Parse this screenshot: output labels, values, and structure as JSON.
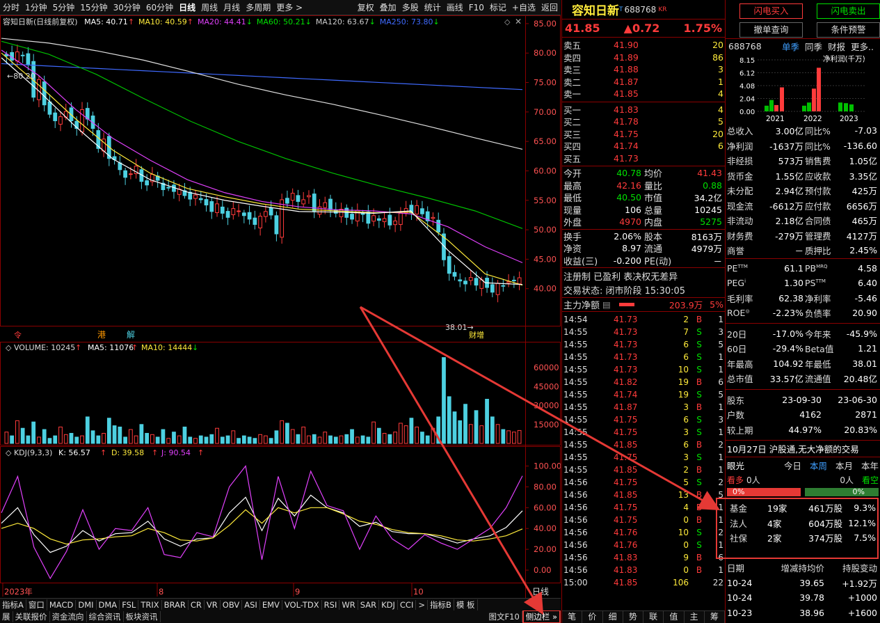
{
  "toolbar": {
    "left": [
      "分时",
      "1分钟",
      "5分钟",
      "15分钟",
      "30分钟",
      "60分钟",
      "日线",
      "周线",
      "月线",
      "多周期",
      "更多 >"
    ],
    "right": [
      "复权",
      "叠加",
      "多股",
      "统计",
      "画线",
      "F10",
      "标记",
      "+自选",
      "返回"
    ]
  },
  "chart": {
    "stock_title": "容知日新(日线前复权)",
    "ma": [
      {
        "label": "MA5: 40.71",
        "arrow": "↑",
        "color": "#ffffff"
      },
      {
        "label": "MA10: 40.59",
        "arrow": "↑",
        "color": "#ffeb3b"
      },
      {
        "label": "MA20: 44.41",
        "arrow": "↓",
        "color": "#e040fb"
      },
      {
        "label": "MA60: 50.21",
        "arrow": "↓",
        "color": "#00e000"
      },
      {
        "label": "MA120: 63.67",
        "arrow": "↓",
        "color": "#cccccc"
      },
      {
        "label": "MA250: 73.80",
        "arrow": "↓",
        "color": "#3f6aff"
      }
    ],
    "high_label": "80.20",
    "low_label": "38.01",
    "event_labels": [
      "港",
      "解",
      "财增"
    ],
    "volume_title": "VOLUME: 10245",
    "volume_ma5": "MA5: 11076",
    "volume_ma10": "MA10: 14444",
    "kdj_title": "KDJ(9,3,3)",
    "kdj_k": "K: 56.57",
    "kdj_d": "D: 39.58",
    "kdj_j": "J: 90.54",
    "x_labels": [
      "2023年",
      "8",
      "9",
      "10"
    ],
    "cycle_label": "日线"
  },
  "chart_data": [
    {
      "type": "candlestick",
      "title": "容知日新(日线前复权)",
      "ylim": [
        35,
        87
      ],
      "yticks": [
        40,
        45,
        50,
        55,
        60,
        65,
        70,
        75,
        80,
        85
      ],
      "close": [
        79.5,
        78.8,
        80.2,
        79.6,
        78.1,
        72.5,
        75.5,
        71.2,
        69.6,
        68.5,
        69.2,
        70.1,
        68.5,
        67.2,
        70.4,
        68.8,
        67.2,
        63.8,
        65.4,
        62.1,
        61.9,
        60.2,
        58.9,
        59.5,
        60.8,
        58.2,
        57.6,
        59.4,
        58.4,
        56.8,
        57.2,
        56.5,
        56.9,
        55.8,
        55.2,
        55.9,
        55.1,
        54.2,
        53.1,
        54.4,
        52.8,
        52.1,
        53.6,
        53.2,
        52.4,
        51.8,
        50.9,
        52.3,
        53.1,
        52.5,
        49.3,
        55.1,
        54.5,
        56.2,
        54.8,
        55.1,
        55.8,
        53.2,
        53.9,
        54.6,
        53.4,
        52.8,
        53.5,
        52.1,
        51.8,
        53.3,
        52.6,
        51.1,
        52.4,
        51.6,
        51.9,
        50.8,
        51.5,
        52.8,
        53.6,
        52.9,
        54.1,
        52.7,
        51.5,
        52.1,
        49.6,
        44.9,
        42.6,
        42.1,
        41.3,
        40.8,
        41.9,
        40.6,
        41.5,
        40.2,
        39.4,
        40.9,
        40.5,
        41.2,
        41.4,
        41.85
      ],
      "ma250": [
        78.2,
        78.0,
        77.8,
        77.6,
        77.4,
        77.2,
        77.0,
        76.8,
        76.6,
        76.4,
        76.2,
        76.0,
        75.8,
        75.6,
        75.4,
        75.2,
        75.0,
        74.8,
        74.6,
        74.4,
        74.2,
        74.0,
        73.8
      ],
      "ma120": [
        82.5,
        81.7,
        80.4,
        78.8,
        76.8,
        74.7,
        72.9,
        71.3,
        69.5,
        67.6,
        65.6,
        63.67
      ],
      "ma60": [
        82.0,
        79.8,
        76.4,
        72.3,
        68.4,
        65.0,
        62.1,
        59.6,
        57.4,
        55.4,
        53.2,
        50.21
      ],
      "ma20": [
        80.5,
        76.2,
        70.4,
        65.5,
        61.8,
        58.5,
        56.3,
        54.8,
        53.9,
        53.4,
        53.2,
        52.7,
        50.5,
        47.1,
        44.41
      ],
      "ma10": [
        80.0,
        74.6,
        68.8,
        63.5,
        59.6,
        57.0,
        55.6,
        54.4,
        53.5,
        53.2,
        52.9,
        53.0,
        48.2,
        42.5,
        40.59
      ],
      "ma5": [
        79.2,
        73.6,
        67.5,
        62.0,
        58.5,
        56.4,
        55.0,
        54.0,
        53.1,
        53.0,
        52.8,
        53.2,
        46.5,
        41.0,
        40.71
      ]
    },
    {
      "type": "bar",
      "title": "VOLUME",
      "ylim": [
        0,
        70000
      ],
      "yticks": [
        15000,
        30000,
        45000,
        60000
      ],
      "values": [
        9000,
        6000,
        18000,
        12000,
        6000,
        17000,
        5000,
        11000,
        4000,
        6000,
        13000,
        7000,
        8000,
        5000,
        6000,
        21000,
        10000,
        6000,
        8000,
        20000,
        14000,
        13000,
        5000,
        11000,
        6000,
        15000,
        8000,
        7000,
        5000,
        11000,
        4000,
        9000,
        6000,
        13000,
        5000,
        4000,
        6000,
        5000,
        7000,
        12000,
        5000,
        6000,
        10000,
        4000,
        6000,
        5000,
        4000,
        7000,
        6000,
        4000,
        10000,
        18000,
        16000,
        11000,
        7000,
        13000,
        6000,
        7000,
        5000,
        9000,
        6000,
        5000,
        6000,
        7000,
        11000,
        5000,
        6000,
        5000,
        17000,
        12000,
        8000,
        7000,
        9000,
        16000,
        14000,
        20000,
        13000,
        9000,
        6000,
        12000,
        21000,
        68000,
        37000,
        25000,
        18000,
        31000,
        15000,
        26000,
        14000,
        35000,
        21000,
        15000,
        11000,
        10000,
        9000,
        10245
      ],
      "ma5": [
        11076
      ],
      "ma10": [
        14444
      ]
    },
    {
      "type": "line",
      "title": "KDJ(9,3,3)",
      "ylim": [
        -10,
        105
      ],
      "yticks": [
        0,
        20,
        40,
        60,
        80,
        100
      ],
      "series": [
        {
          "name": "K",
          "values": [
            45,
            60,
            34,
            17,
            23,
            38,
            28,
            35,
            36,
            47,
            30,
            23,
            30,
            31,
            55,
            70,
            38,
            69,
            52,
            72,
            60,
            55,
            42,
            46,
            37,
            35,
            35,
            31,
            26,
            30,
            33,
            41,
            57
          ]
        },
        {
          "name": "D",
          "values": [
            40,
            45,
            40,
            30,
            25,
            29,
            30,
            32,
            33,
            40,
            36,
            29,
            28,
            31,
            43,
            58,
            45,
            60,
            55,
            60,
            60,
            54,
            47,
            44,
            39,
            36,
            35,
            33,
            29,
            28,
            30,
            33,
            39.58
          ]
        },
        {
          "name": "J",
          "values": [
            55,
            90,
            22,
            -8,
            18,
            58,
            20,
            40,
            38,
            60,
            15,
            12,
            36,
            32,
            80,
            100,
            10,
            90,
            40,
            95,
            62,
            57,
            20,
            52,
            30,
            20,
            34,
            26,
            20,
            30,
            40,
            60,
            90.54
          ]
        }
      ]
    }
  ],
  "mid": {
    "name": "容知日新",
    "name_flag": "T",
    "code": "688768",
    "code_tag": "KR",
    "price": "41.85",
    "change": "▲0.72",
    "pct": "1.75%",
    "asks": [
      {
        "label": "卖五",
        "price": "41.90",
        "vol": "20"
      },
      {
        "label": "卖四",
        "price": "41.89",
        "vol": "86"
      },
      {
        "label": "卖三",
        "price": "41.88",
        "vol": "3"
      },
      {
        "label": "卖二",
        "price": "41.87",
        "vol": "1"
      },
      {
        "label": "卖一",
        "price": "41.85",
        "vol": "4"
      }
    ],
    "bids": [
      {
        "label": "买一",
        "price": "41.83",
        "vol": "4"
      },
      {
        "label": "买二",
        "price": "41.78",
        "vol": "5"
      },
      {
        "label": "买三",
        "price": "41.75",
        "vol": "20"
      },
      {
        "label": "买四",
        "price": "41.74",
        "vol": "6"
      },
      {
        "label": "买五",
        "price": "41.73",
        "vol": ""
      }
    ],
    "stats": [
      {
        "l1": "今开",
        "v1": "40.78",
        "c1": "green",
        "l2": "均价",
        "v2": "41.43",
        "c2": "red"
      },
      {
        "l1": "最高",
        "v1": "42.16",
        "c1": "red",
        "l2": "量比",
        "v2": "0.88",
        "c2": "green"
      },
      {
        "l1": "最低",
        "v1": "40.50",
        "c1": "green",
        "l2": "市值",
        "v2": "34.2亿",
        "c2": "white"
      },
      {
        "l1": "现量",
        "v1": "106",
        "c1": "white",
        "l2": "总量",
        "v2": "10245",
        "c2": "white"
      },
      {
        "l1": "外盘",
        "v1": "4970",
        "c1": "red",
        "l2": "内盘",
        "v2": "5275",
        "c2": "green"
      }
    ],
    "stats2": [
      {
        "l1": "换手",
        "v1": "2.06%",
        "l2": "股本",
        "v2": "8163万"
      },
      {
        "l1": "净资",
        "v1": "8.97",
        "l2": "流通",
        "v2": "4979万"
      },
      {
        "l1": "收益(三)",
        "v1": "-0.200",
        "l2": "PE(动)",
        "v2": "－"
      }
    ],
    "reg": "注册制 已盈利 表决权无差异",
    "trade_status": "交易状态: 闭市阶段 15:30:05",
    "main_net_label": "主力净额",
    "main_net_value": "203.9万",
    "main_net_pct": "5%",
    "ticks": [
      {
        "t": "14:54",
        "p": "41.73",
        "pc": "red",
        "v": "2",
        "d": "B",
        "dc": "red",
        "n": "1"
      },
      {
        "t": "14:55",
        "p": "41.73",
        "pc": "red",
        "v": "7",
        "d": "S",
        "dc": "green",
        "n": "3"
      },
      {
        "t": "14:55",
        "p": "41.73",
        "pc": "red",
        "v": "6",
        "d": "S",
        "dc": "green",
        "n": "5"
      },
      {
        "t": "14:55",
        "p": "41.73",
        "pc": "red",
        "v": "6",
        "d": "S",
        "dc": "green",
        "n": "1"
      },
      {
        "t": "14:55",
        "p": "41.73",
        "pc": "red",
        "v": "10",
        "d": "S",
        "dc": "green",
        "n": "1"
      },
      {
        "t": "14:55",
        "p": "41.82",
        "pc": "red",
        "v": "19",
        "d": "B",
        "dc": "red",
        "n": "6"
      },
      {
        "t": "14:55",
        "p": "41.74",
        "pc": "red",
        "v": "19",
        "d": "S",
        "dc": "green",
        "n": "5"
      },
      {
        "t": "14:55",
        "p": "41.87",
        "pc": "red",
        "v": "3",
        "d": "B",
        "dc": "red",
        "n": "1"
      },
      {
        "t": "14:55",
        "p": "41.75",
        "pc": "red",
        "v": "6",
        "d": "S",
        "dc": "green",
        "n": "3"
      },
      {
        "t": "14:55",
        "p": "41.75",
        "pc": "red",
        "v": "3",
        "d": "S",
        "dc": "green",
        "n": "1"
      },
      {
        "t": "14:55",
        "p": "41.85",
        "pc": "red",
        "v": "6",
        "d": "B",
        "dc": "red",
        "n": "2"
      },
      {
        "t": "14:55",
        "p": "41.75",
        "pc": "red",
        "v": "3",
        "d": "S",
        "dc": "green",
        "n": "1"
      },
      {
        "t": "14:55",
        "p": "41.85",
        "pc": "red",
        "v": "2",
        "d": "B",
        "dc": "red",
        "n": "1"
      },
      {
        "t": "14:56",
        "p": "41.75",
        "pc": "red",
        "v": "5",
        "d": "S",
        "dc": "green",
        "n": "2"
      },
      {
        "t": "14:56",
        "p": "41.85",
        "pc": "red",
        "v": "13",
        "d": "B",
        "dc": "red",
        "n": "5"
      },
      {
        "t": "14:56",
        "p": "41.75",
        "pc": "red",
        "v": "4",
        "d": "B",
        "dc": "red",
        "n": "1"
      },
      {
        "t": "14:56",
        "p": "41.75",
        "pc": "red",
        "v": "0",
        "d": "B",
        "dc": "red",
        "n": "1"
      },
      {
        "t": "14:56",
        "p": "41.76",
        "pc": "red",
        "v": "10",
        "d": "S",
        "dc": "green",
        "n": "2"
      },
      {
        "t": "14:56",
        "p": "41.76",
        "pc": "red",
        "v": "0",
        "d": "S",
        "dc": "green",
        "n": "1"
      },
      {
        "t": "14:56",
        "p": "41.83",
        "pc": "red",
        "v": "9",
        "d": "B",
        "dc": "red",
        "n": "6"
      },
      {
        "t": "14:56",
        "p": "41.83",
        "pc": "red",
        "v": "0",
        "d": "B",
        "dc": "red",
        "n": "1"
      },
      {
        "t": "15:00",
        "p": "41.85",
        "pc": "red",
        "v": "106",
        "d": "",
        "dc": "white",
        "n": "22"
      }
    ],
    "bottom_tabs": [
      "笔",
      "价",
      "细",
      "势",
      "联",
      "值",
      "主",
      "筹"
    ]
  },
  "right": {
    "buy_btn": "闪电买入",
    "sell_btn": "闪电卖出",
    "cancel_btn": "撤单查询",
    "alert_btn": "条件预警",
    "code": "688768",
    "tabs": [
      "单季",
      "同季",
      "财报",
      "更多.."
    ],
    "fin_chart_title": "净利润(千万)",
    "fin_yticks": [
      "8.15",
      "6.12",
      "4.08",
      "2.04",
      "0.00"
    ],
    "fin_years": [
      "2021",
      "2022",
      "2023"
    ],
    "fin": [
      {
        "l1": "总收入",
        "v1": "3.00亿",
        "l2": "同比%",
        "v2": "-7.03"
      },
      {
        "l1": "净利润",
        "v1": "-1637万",
        "l2": "同比%",
        "v2": "-136.60"
      },
      {
        "l1": "非经损",
        "v1": "573万",
        "l2": "销售费",
        "v2": "1.05亿"
      },
      {
        "l1": "货币金",
        "v1": "1.55亿",
        "l2": "应收款",
        "v2": "3.35亿"
      },
      {
        "l1": "未分配",
        "v1": "2.94亿",
        "l2": "预付款",
        "v2": "425万"
      },
      {
        "l1": "现金流",
        "v1": "-6612万",
        "l2": "应付款",
        "v2": "6656万"
      },
      {
        "l1": "非流动",
        "v1": "2.18亿",
        "l2": "合同债",
        "v2": "465万"
      },
      {
        "l1": "财务费",
        "v1": "-279万",
        "l2": "管理费",
        "v2": "4127万"
      },
      {
        "l1": "商誉",
        "v1": "－",
        "l2": "质押比",
        "v2": "2.45%"
      }
    ],
    "val": [
      {
        "l1": "PE",
        "s1": "TTM",
        "v1": "61.1",
        "l2": "PB",
        "s2": "MRQ",
        "v2": "4.58"
      },
      {
        "l1": "PEG",
        "s1": "i",
        "v1": "1.30",
        "l2": "PS",
        "s2": "TTM",
        "v2": "6.40"
      },
      {
        "l1": "毛利率",
        "s1": "",
        "v1": "62.38",
        "l2": "净利率",
        "s2": "",
        "v2": "-5.46"
      },
      {
        "l1": "ROE",
        "s1": "◎",
        "v1": "-2.23%",
        "l2": "负债率",
        "s2": "",
        "v2": "20.90"
      }
    ],
    "perf": [
      {
        "l1": "20日",
        "v1": "-17.0%",
        "l2": "今年来",
        "v2": "-45.9%"
      },
      {
        "l1": "60日",
        "v1": "-29.4%",
        "l2": "Beta值",
        "v2": "1.21"
      },
      {
        "l1": "年最高",
        "v1": "104.92",
        "l2": "年最低",
        "v2": "38.01"
      },
      {
        "l1": "总市值",
        "v1": "33.57亿",
        "l2": "流通值",
        "v2": "20.48亿"
      }
    ],
    "holders": [
      {
        "l": "股东",
        "a": "23-09-30",
        "b": "23-06-30"
      },
      {
        "l": "户数",
        "a": "4162",
        "b": "2871"
      },
      {
        "l": "较上期",
        "a": "44.97%",
        "b": "20.83%"
      }
    ],
    "notice": "10月27日 沪股通,无大净额的交易",
    "eye_label": "眼光",
    "eye_tabs": [
      "今日",
      "本周",
      "本月",
      "本年"
    ],
    "bull_label": "看多",
    "bull_count": "0人",
    "bear_count": "0人",
    "bear_label": "看空",
    "bull_pct": "0%",
    "bear_pct": "0%",
    "inst": [
      {
        "l": "基金",
        "n": "19家",
        "s": "461万股",
        "p": "9.3%"
      },
      {
        "l": "法人",
        "n": "4家",
        "s": "604万股",
        "p": "12.1%"
      },
      {
        "l": "社保",
        "n": "2家",
        "s": "374万股",
        "p": "7.5%"
      }
    ],
    "hold_header": [
      "日期",
      "增减持均价",
      "持股变动"
    ],
    "hold_rows": [
      {
        "d": "10-24",
        "p": "39.65",
        "c": "+1.92万"
      },
      {
        "d": "10-24",
        "p": "39.78",
        "c": "+1000"
      },
      {
        "d": "10-23",
        "p": "38.96",
        "c": "+1600"
      }
    ]
  },
  "bottom": {
    "indicators": [
      "指标A",
      "窗口",
      "MACD",
      "DMI",
      "DMA",
      "FSL",
      "TRIX",
      "BRAR",
      "CR",
      "VR",
      "OBV",
      "ASI",
      "EMV",
      "VOL-TDX",
      "RSI",
      "WR",
      "SAR",
      "KDJ",
      "CCI",
      ">",
      "指标B",
      "模 板"
    ],
    "links": [
      "展​",
      "关联报价",
      "资金流向",
      "综合资讯",
      "板块资讯"
    ],
    "f10": "图文F10",
    "sidebar": "侧边栏 »"
  }
}
